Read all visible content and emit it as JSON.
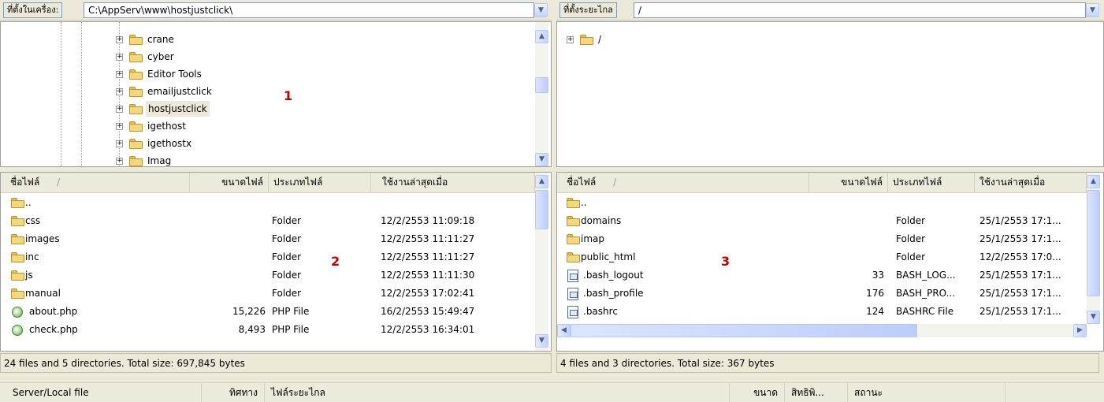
{
  "local_address": {
    "label": "ที่ตั้งในเครื่อง:",
    "value": "C:\\AppServ\\www\\hostjustclick\\"
  },
  "remote_address": {
    "label": "ที่ตั้งระยะไกล",
    "value": "/"
  },
  "local_tree": {
    "items": [
      "crane",
      "cyber",
      "Editor Tools",
      "emailjustclick",
      "hostjustclick",
      "igethost",
      "igethostx",
      "Imag"
    ],
    "selected": "hostjustclick",
    "marker": "1"
  },
  "remote_tree": {
    "items": [
      "/"
    ]
  },
  "columns": {
    "name": "ชื่อไฟล์",
    "sort": "/",
    "size": "ขนาดไฟล์",
    "type": "ประเภทไฟล์",
    "modified": "ใช้งานล่าสุดเมื่อ"
  },
  "local_files": {
    "marker": "2",
    "rows": [
      {
        "name": "..",
        "size": "",
        "type": "",
        "modified": "",
        "icon": "folder-icon"
      },
      {
        "name": "css",
        "size": "",
        "type": "Folder",
        "modified": "12/2/2553 11:09:18",
        "icon": "folder-icon"
      },
      {
        "name": "images",
        "size": "",
        "type": "Folder",
        "modified": "12/2/2553 11:11:27",
        "icon": "folder-icon"
      },
      {
        "name": "inc",
        "size": "",
        "type": "Folder",
        "modified": "12/2/2553 11:11:27",
        "icon": "folder-icon"
      },
      {
        "name": "js",
        "size": "",
        "type": "Folder",
        "modified": "12/2/2553 11:11:30",
        "icon": "folder-icon"
      },
      {
        "name": "manual",
        "size": "",
        "type": "Folder",
        "modified": "12/2/2553 17:02:41",
        "icon": "folder-icon"
      },
      {
        "name": "about.php",
        "size": "15,226",
        "type": "PHP File",
        "modified": "16/2/2553 15:49:47",
        "icon": "php-file-icon"
      },
      {
        "name": "check.php",
        "size": "8,493",
        "type": "PHP File",
        "modified": "12/2/2553 16:34:01",
        "icon": "php-file-icon"
      }
    ],
    "status": "24 files and 5 directories. Total size: 697,845 bytes"
  },
  "remote_files": {
    "marker": "3",
    "rows": [
      {
        "name": "..",
        "size": "",
        "type": "",
        "modified": "",
        "icon": "folder-icon"
      },
      {
        "name": "domains",
        "size": "",
        "type": "Folder",
        "modified": "25/1/2553 17:1...",
        "icon": "folder-icon"
      },
      {
        "name": "imap",
        "size": "",
        "type": "Folder",
        "modified": "25/1/2553 17:1...",
        "icon": "folder-icon"
      },
      {
        "name": "public_html",
        "size": "",
        "type": "Folder",
        "modified": "12/2/2553 17:0...",
        "icon": "folder-icon"
      },
      {
        "name": ".bash_logout",
        "size": "33",
        "type": "BASH_LOG...",
        "modified": "25/1/2553 17:1...",
        "icon": "document-icon"
      },
      {
        "name": ".bash_profile",
        "size": "176",
        "type": "BASH_PRO...",
        "modified": "25/1/2553 17:1...",
        "icon": "document-icon"
      },
      {
        "name": ".bashrc",
        "size": "124",
        "type": "BASHRC File",
        "modified": "25/1/2553 17:1...",
        "icon": "document-icon"
      }
    ],
    "status": "4 files and 3 directories. Total size: 367 bytes"
  },
  "queue_header": {
    "server_local": "Server/Local file",
    "direction": "ทิศทาง",
    "remote_file": "ไฟล์ระยะไกล",
    "size": "ขนาด",
    "priority": "สิทธิพิ...",
    "status": "สถานะ"
  }
}
